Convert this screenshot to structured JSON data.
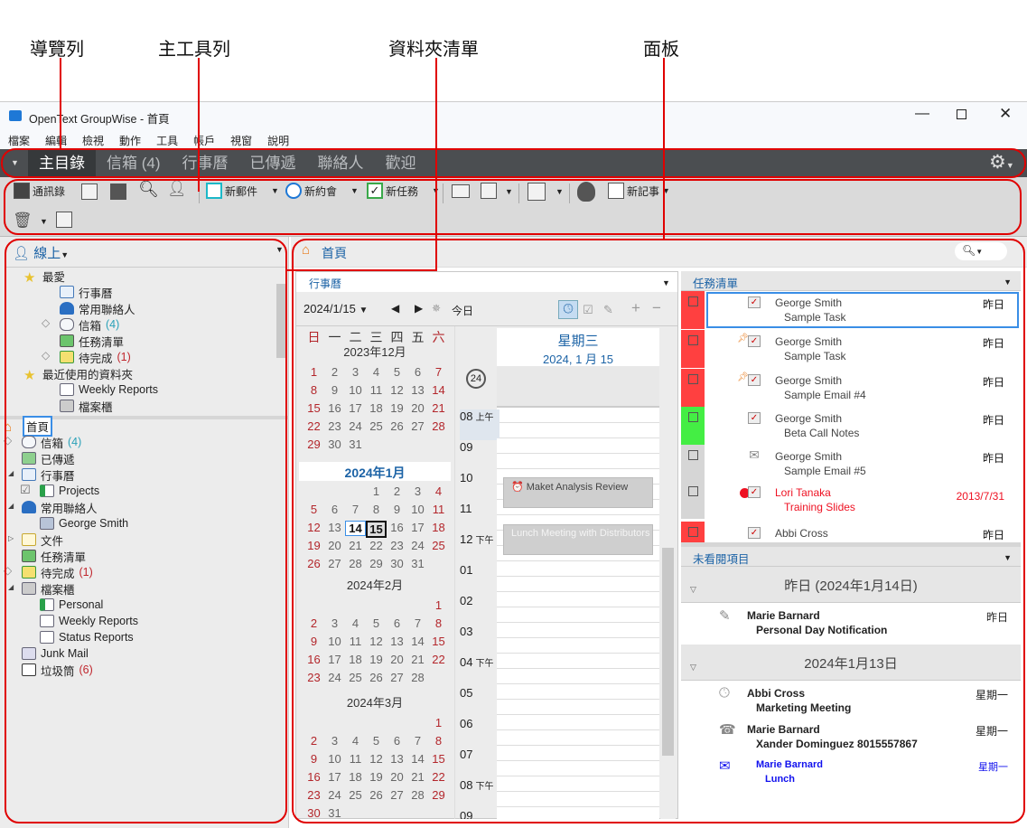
{
  "callouts": {
    "nav": "導覽列",
    "toolbar": "主工具列",
    "folders": "資料夾清單",
    "panels": "面板"
  },
  "window": {
    "title": "OpenText GroupWise - 首頁"
  },
  "menu": [
    "檔案",
    "編輯",
    "檢視",
    "動作",
    "工具",
    "帳戶",
    "視窗",
    "說明"
  ],
  "nav": {
    "tabs": [
      "主目錄",
      "信箱 (4)",
      "行事曆",
      "已傳遞",
      "聯絡人",
      "歡迎"
    ],
    "active": 0
  },
  "toolbar": {
    "address_book": "通訊錄",
    "new_mail": "新郵件",
    "new_appt": "新約會",
    "new_task": "新任務",
    "new_note": "新記事"
  },
  "left": {
    "mode": "線上",
    "favorites": [
      {
        "label": "最愛",
        "level": 0,
        "icon": "star"
      },
      {
        "label": "行事曆",
        "level": 2,
        "icon": "calendar"
      },
      {
        "label": "常用聯絡人",
        "level": 2,
        "icon": "contacts"
      },
      {
        "label": "信箱",
        "count": "(4)",
        "countColor": "b",
        "level": 2,
        "icon": "inbox",
        "diamond": true
      },
      {
        "label": "任務清單",
        "level": 2,
        "icon": "tasklist"
      },
      {
        "label": "待完成",
        "count": "(1)",
        "countColor": "r",
        "level": 2,
        "icon": "worklist",
        "diamond": true
      },
      {
        "label": "最近使用的資料夾",
        "level": 0,
        "icon": "star"
      },
      {
        "label": "Weekly Reports",
        "level": 2,
        "icon": "folder"
      },
      {
        "label": "檔案櫃",
        "level": 2,
        "icon": "cabinet"
      }
    ],
    "tree": [
      {
        "label": "首頁",
        "level": 0,
        "icon": "home",
        "selected": true
      },
      {
        "label": "信箱",
        "count": "(4)",
        "countColor": "b",
        "level": 1,
        "icon": "inbox",
        "diamond": true
      },
      {
        "label": "已傳遞",
        "level": 1,
        "icon": "sent"
      },
      {
        "label": "行事曆",
        "level": 1,
        "icon": "calendar",
        "expand": "open"
      },
      {
        "label": "Projects",
        "level": 2,
        "icon": "shared-folder",
        "check": true
      },
      {
        "label": "常用聯絡人",
        "level": 1,
        "icon": "contacts",
        "expand": "open"
      },
      {
        "label": "George Smith",
        "level": 2,
        "icon": "addressbook"
      },
      {
        "label": "文件",
        "level": 1,
        "icon": "documents",
        "expand": "closed"
      },
      {
        "label": "任務清單",
        "level": 1,
        "icon": "tasklist"
      },
      {
        "label": "待完成",
        "count": "(1)",
        "countColor": "r",
        "level": 1,
        "icon": "worklist",
        "diamond": true
      },
      {
        "label": "檔案櫃",
        "level": 1,
        "icon": "cabinet",
        "expand": "open"
      },
      {
        "label": "Personal",
        "level": 2,
        "icon": "shared-folder"
      },
      {
        "label": "Weekly Reports",
        "level": 2,
        "icon": "folder"
      },
      {
        "label": "Status Reports",
        "level": 2,
        "icon": "folder"
      },
      {
        "label": "Junk Mail",
        "level": 1,
        "icon": "junk"
      },
      {
        "label": "垃圾筒",
        "count": "(6)",
        "countColor": "r",
        "level": 1,
        "icon": "trash"
      }
    ]
  },
  "main": {
    "title": "首頁",
    "calendar": {
      "panel_title": "行事曆",
      "date": "2024/1/15",
      "today": "今日",
      "weekdays": [
        "日",
        "一",
        "二",
        "三",
        "四",
        "五",
        "六"
      ],
      "months": [
        {
          "title": "2023年12月",
          "start": 0,
          "days": 31
        },
        {
          "title": "2024年1月",
          "start": 3,
          "days": 31,
          "current": true,
          "today": 14,
          "selected": 15
        },
        {
          "title": "2024年2月",
          "start": 6,
          "days": 28
        },
        {
          "title": "2024年3月",
          "start": 6,
          "days": 31
        }
      ],
      "day_header": {
        "weekday": "星期三",
        "date": "2024, 1 月 15"
      },
      "allday_icon": "24",
      "hours": [
        {
          "h": "08",
          "ampm": "上午"
        },
        {
          "h": "09"
        },
        {
          "h": "10"
        },
        {
          "h": "11"
        },
        {
          "h": "12",
          "ampm": "下午"
        },
        {
          "h": "01"
        },
        {
          "h": "02"
        },
        {
          "h": "03"
        },
        {
          "h": "04",
          "ampm": "下午"
        },
        {
          "h": "05"
        },
        {
          "h": "06"
        },
        {
          "h": "07"
        },
        {
          "h": "08",
          "ampm": "下午"
        },
        {
          "h": "09"
        }
      ],
      "events": [
        {
          "title": "Maket Analysis Review",
          "start_hour": 10.25,
          "end_hour": 11.25,
          "icons": true
        },
        {
          "title": "Lunch Meeting with Distributors",
          "start_hour": 11.8,
          "end_hour": 12.8
        }
      ]
    },
    "tasks": {
      "title": "任務清單",
      "items": [
        {
          "from": "George Smith",
          "subject": "Sample Task",
          "date": "昨日",
          "flag": "#ff4040",
          "icon": "task",
          "selected": true
        },
        {
          "from": "George Smith",
          "subject": "Sample Task",
          "date": "昨日",
          "flag": "#ff4040",
          "icon": "task",
          "pin": true
        },
        {
          "from": "George Smith",
          "subject": "Sample Email #4",
          "date": "昨日",
          "flag": "#ff4040",
          "icon": "task",
          "pin": true
        },
        {
          "from": "George Smith",
          "subject": "Beta Call Notes",
          "date": "昨日",
          "flag": "#44ee44",
          "icon": "task"
        },
        {
          "from": "George Smith",
          "subject": "Sample Email #5",
          "date": "昨日",
          "flag": "#d6d6d6",
          "icon": "mail"
        },
        {
          "from": "Lori Tanaka",
          "subject": "Training Slides",
          "date": "2013/7/31",
          "flag": "#d6d6d6",
          "icon": "task",
          "overdue": true
        },
        {
          "from": "Abbi Cross",
          "subject": "",
          "date": "昨日",
          "flag": "#ff4040",
          "icon": "task"
        }
      ]
    },
    "unread": {
      "title": "未看閱項目",
      "groups": [
        {
          "label": "昨日 (2024年1月14日)",
          "items": [
            {
              "from": "Marie Barnard",
              "subject": "Personal Day Notification",
              "date": "昨日",
              "icon": "note"
            }
          ]
        },
        {
          "label": "2024年1月13日",
          "items": [
            {
              "from": "Abbi Cross",
              "subject": "Marketing Meeting",
              "date": "星期一",
              "icon": "clock"
            },
            {
              "from": "Marie Barnard",
              "subject": "Xander Dominguez 8015557867",
              "date": "星期一",
              "icon": "phone"
            },
            {
              "from": "Marie Barnard",
              "subject": "Lunch",
              "date": "星期一",
              "icon": "mail",
              "blue": true
            }
          ]
        }
      ]
    }
  },
  "colors": {
    "accent": "#1c63a6",
    "nav_bg": "#4b4e51",
    "annotation": "#e00000",
    "overdue": "#ee1122",
    "blue_item": "#1111ee"
  }
}
